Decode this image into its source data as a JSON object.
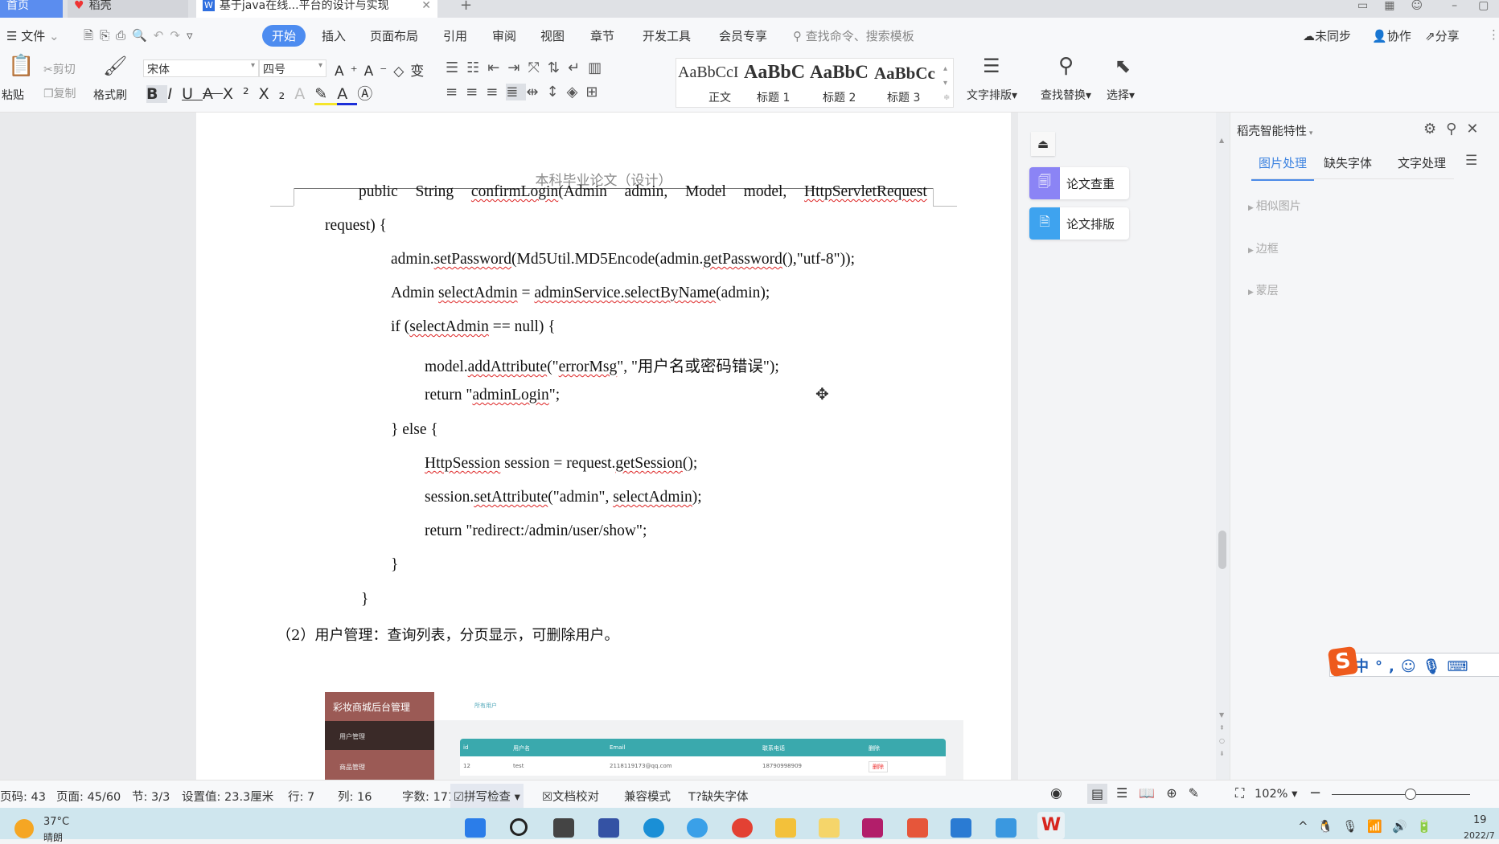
{
  "tabs": [
    {
      "label": "首页",
      "active": false
    },
    {
      "label": "稻壳",
      "active": false
    },
    {
      "label": "基于java在线...平台的设计与实现",
      "active": true
    }
  ],
  "menu": {
    "file": "文件",
    "items": [
      "开始",
      "插入",
      "页面布局",
      "引用",
      "审阅",
      "视图",
      "章节",
      "开发工具",
      "会员专享"
    ],
    "active": "开始",
    "search_placeholder": "查找命令、搜索模板",
    "sync": "未同步",
    "collab": "协作",
    "share": "分享"
  },
  "ribbon": {
    "paste": "粘贴",
    "cut": "剪切",
    "copy": "复制",
    "format_painter": "格式刷",
    "font": "宋体",
    "size": "四号",
    "styles": [
      {
        "preview": "AaBbCcI",
        "label": "正文"
      },
      {
        "preview": "AaBbC",
        "label": "标题 1"
      },
      {
        "preview": "AaBbC",
        "label": "标题 2"
      },
      {
        "preview": "AaBbCc",
        "label": "标题 3"
      }
    ],
    "text_layout": "文字排版",
    "find_replace": "查找替换",
    "select": "选择"
  },
  "document": {
    "header": "本科毕业论文（设计）",
    "lines": [
      [
        {
          "t": "public  String  "
        },
        {
          "t": "confirmLogin",
          "e": true
        },
        {
          "t": "(Admin  admin,  Model  model,  "
        },
        {
          "t": "HttpServletRequest",
          "e": true
        }
      ],
      [
        {
          "t": "request) {"
        }
      ],
      [
        {
          "t": "admin."
        },
        {
          "t": "setPassword",
          "e": true
        },
        {
          "t": "(Md5Util.MD5Encode(admin."
        },
        {
          "t": "getPassword",
          "e": true
        },
        {
          "t": "(),\"utf-8\"));"
        }
      ],
      [
        {
          "t": "Admin "
        },
        {
          "t": "selectAdmin",
          "e": true
        },
        {
          "t": " = "
        },
        {
          "t": "adminService.selectByName",
          "e": true
        },
        {
          "t": "(admin);"
        }
      ],
      [
        {
          "t": "if ("
        },
        {
          "t": "selectAdmin",
          "e": true
        },
        {
          "t": " == null) {"
        }
      ],
      [
        {
          "t": "model."
        },
        {
          "t": "addAttribute",
          "e": true
        },
        {
          "t": "(\""
        },
        {
          "t": "errorMsg",
          "e": true
        },
        {
          "t": "\", \"用户名或密码错误\");"
        }
      ],
      [
        {
          "t": "return \""
        },
        {
          "t": "adminLogin",
          "e": true
        },
        {
          "t": "\";"
        }
      ],
      [
        {
          "t": "} else {"
        }
      ],
      [
        {
          "t": "HttpSession",
          "e": true
        },
        {
          "t": " session = request."
        },
        {
          "t": "getSession",
          "e": true
        },
        {
          "t": "();"
        }
      ],
      [
        {
          "t": "session."
        },
        {
          "t": "setAttribute",
          "e": true
        },
        {
          "t": "(\"admin\", "
        },
        {
          "t": "selectAdmin",
          "e": true
        },
        {
          "t": ");"
        }
      ],
      [
        {
          "t": "return \"redirect:/admin/user/show\";"
        }
      ],
      [
        {
          "t": "}"
        }
      ],
      [
        {
          "t": "}"
        }
      ],
      [
        {
          "t": "（2）用户管理：查询列表，分页显示，可删除用户。"
        }
      ]
    ],
    "figure": {
      "brand": "彩妆商城后台管理",
      "nav": [
        "用户管理",
        "商品管理"
      ],
      "tab": "所有用户",
      "columns": [
        "id",
        "用户名",
        "Email",
        "联系电话",
        "删除"
      ],
      "row": [
        "12",
        "test",
        "2118119173@qq.com",
        "18790998909",
        "删除"
      ]
    }
  },
  "floatbuttons": [
    {
      "label": "论文查重",
      "color": "#8b84f5"
    },
    {
      "label": "论文排版",
      "color": "#3ea3ef"
    }
  ],
  "sidepanel": {
    "title": "稻壳智能特性",
    "tabs": [
      "图片处理",
      "缺失字体",
      "文字处理"
    ],
    "active_tab": "图片处理",
    "sections": [
      "相似图片",
      "边框",
      "蒙层"
    ]
  },
  "status": {
    "page_code": "页码: 43",
    "page": "页面: 45/60",
    "section": "节: 3/3",
    "setting": "设置值: 23.3厘米",
    "row": "行: 7",
    "col": "列: 16",
    "words": "字数: 17158",
    "spell": "拼写检查",
    "proof": "文档校对",
    "compat": "兼容模式",
    "missing_font": "缺失字体",
    "zoom": "102%",
    "zoom_level": 0.57
  },
  "taskbar": {
    "temp": "37°C",
    "weather": "晴朗",
    "time": "19",
    "date": "2022/7"
  },
  "ime": {
    "lang": "中",
    "punct": "°,"
  }
}
